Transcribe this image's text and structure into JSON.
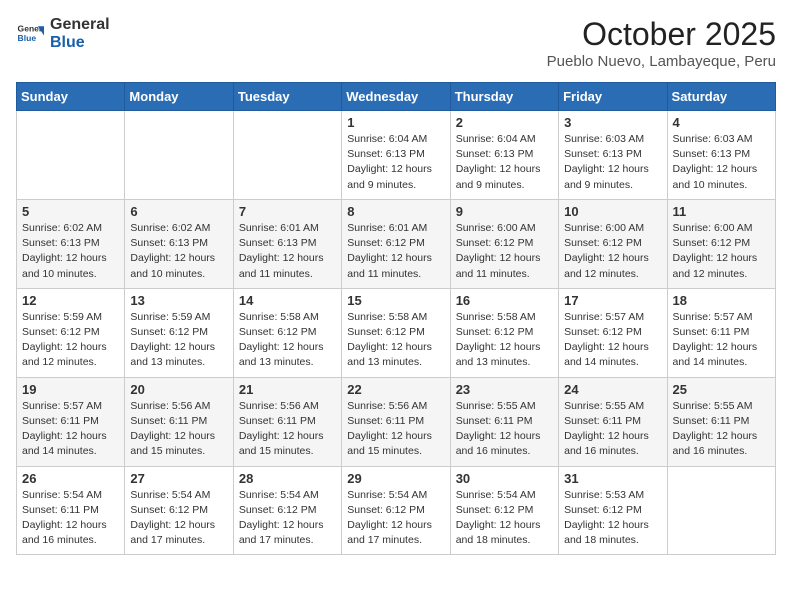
{
  "header": {
    "logo_general": "General",
    "logo_blue": "Blue",
    "month_title": "October 2025",
    "subtitle": "Pueblo Nuevo, Lambayeque, Peru"
  },
  "weekdays": [
    "Sunday",
    "Monday",
    "Tuesday",
    "Wednesday",
    "Thursday",
    "Friday",
    "Saturday"
  ],
  "weeks": [
    [
      {
        "day": "",
        "info": ""
      },
      {
        "day": "",
        "info": ""
      },
      {
        "day": "",
        "info": ""
      },
      {
        "day": "1",
        "info": "Sunrise: 6:04 AM\nSunset: 6:13 PM\nDaylight: 12 hours\nand 9 minutes."
      },
      {
        "day": "2",
        "info": "Sunrise: 6:04 AM\nSunset: 6:13 PM\nDaylight: 12 hours\nand 9 minutes."
      },
      {
        "day": "3",
        "info": "Sunrise: 6:03 AM\nSunset: 6:13 PM\nDaylight: 12 hours\nand 9 minutes."
      },
      {
        "day": "4",
        "info": "Sunrise: 6:03 AM\nSunset: 6:13 PM\nDaylight: 12 hours\nand 10 minutes."
      }
    ],
    [
      {
        "day": "5",
        "info": "Sunrise: 6:02 AM\nSunset: 6:13 PM\nDaylight: 12 hours\nand 10 minutes."
      },
      {
        "day": "6",
        "info": "Sunrise: 6:02 AM\nSunset: 6:13 PM\nDaylight: 12 hours\nand 10 minutes."
      },
      {
        "day": "7",
        "info": "Sunrise: 6:01 AM\nSunset: 6:13 PM\nDaylight: 12 hours\nand 11 minutes."
      },
      {
        "day": "8",
        "info": "Sunrise: 6:01 AM\nSunset: 6:12 PM\nDaylight: 12 hours\nand 11 minutes."
      },
      {
        "day": "9",
        "info": "Sunrise: 6:00 AM\nSunset: 6:12 PM\nDaylight: 12 hours\nand 11 minutes."
      },
      {
        "day": "10",
        "info": "Sunrise: 6:00 AM\nSunset: 6:12 PM\nDaylight: 12 hours\nand 12 minutes."
      },
      {
        "day": "11",
        "info": "Sunrise: 6:00 AM\nSunset: 6:12 PM\nDaylight: 12 hours\nand 12 minutes."
      }
    ],
    [
      {
        "day": "12",
        "info": "Sunrise: 5:59 AM\nSunset: 6:12 PM\nDaylight: 12 hours\nand 12 minutes."
      },
      {
        "day": "13",
        "info": "Sunrise: 5:59 AM\nSunset: 6:12 PM\nDaylight: 12 hours\nand 13 minutes."
      },
      {
        "day": "14",
        "info": "Sunrise: 5:58 AM\nSunset: 6:12 PM\nDaylight: 12 hours\nand 13 minutes."
      },
      {
        "day": "15",
        "info": "Sunrise: 5:58 AM\nSunset: 6:12 PM\nDaylight: 12 hours\nand 13 minutes."
      },
      {
        "day": "16",
        "info": "Sunrise: 5:58 AM\nSunset: 6:12 PM\nDaylight: 12 hours\nand 13 minutes."
      },
      {
        "day": "17",
        "info": "Sunrise: 5:57 AM\nSunset: 6:12 PM\nDaylight: 12 hours\nand 14 minutes."
      },
      {
        "day": "18",
        "info": "Sunrise: 5:57 AM\nSunset: 6:11 PM\nDaylight: 12 hours\nand 14 minutes."
      }
    ],
    [
      {
        "day": "19",
        "info": "Sunrise: 5:57 AM\nSunset: 6:11 PM\nDaylight: 12 hours\nand 14 minutes."
      },
      {
        "day": "20",
        "info": "Sunrise: 5:56 AM\nSunset: 6:11 PM\nDaylight: 12 hours\nand 15 minutes."
      },
      {
        "day": "21",
        "info": "Sunrise: 5:56 AM\nSunset: 6:11 PM\nDaylight: 12 hours\nand 15 minutes."
      },
      {
        "day": "22",
        "info": "Sunrise: 5:56 AM\nSunset: 6:11 PM\nDaylight: 12 hours\nand 15 minutes."
      },
      {
        "day": "23",
        "info": "Sunrise: 5:55 AM\nSunset: 6:11 PM\nDaylight: 12 hours\nand 16 minutes."
      },
      {
        "day": "24",
        "info": "Sunrise: 5:55 AM\nSunset: 6:11 PM\nDaylight: 12 hours\nand 16 minutes."
      },
      {
        "day": "25",
        "info": "Sunrise: 5:55 AM\nSunset: 6:11 PM\nDaylight: 12 hours\nand 16 minutes."
      }
    ],
    [
      {
        "day": "26",
        "info": "Sunrise: 5:54 AM\nSunset: 6:11 PM\nDaylight: 12 hours\nand 16 minutes."
      },
      {
        "day": "27",
        "info": "Sunrise: 5:54 AM\nSunset: 6:12 PM\nDaylight: 12 hours\nand 17 minutes."
      },
      {
        "day": "28",
        "info": "Sunrise: 5:54 AM\nSunset: 6:12 PM\nDaylight: 12 hours\nand 17 minutes."
      },
      {
        "day": "29",
        "info": "Sunrise: 5:54 AM\nSunset: 6:12 PM\nDaylight: 12 hours\nand 17 minutes."
      },
      {
        "day": "30",
        "info": "Sunrise: 5:54 AM\nSunset: 6:12 PM\nDaylight: 12 hours\nand 18 minutes."
      },
      {
        "day": "31",
        "info": "Sunrise: 5:53 AM\nSunset: 6:12 PM\nDaylight: 12 hours\nand 18 minutes."
      },
      {
        "day": "",
        "info": ""
      }
    ]
  ]
}
